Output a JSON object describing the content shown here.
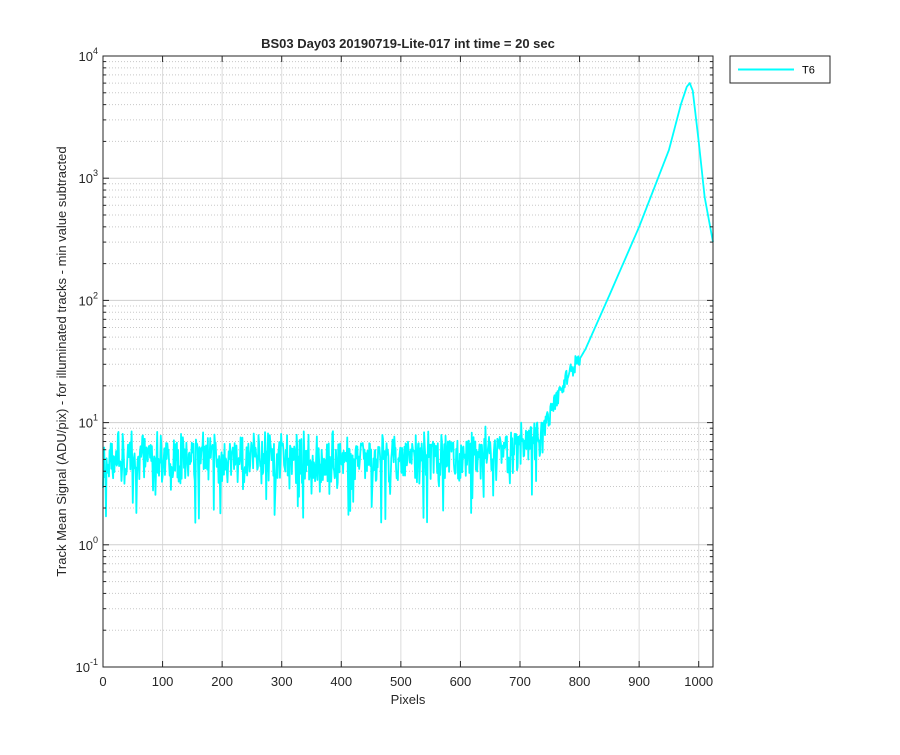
{
  "chart_data": {
    "type": "line",
    "title": "BS03 Day03 20190719-Lite-017 int time = 20 sec",
    "xlabel": "Pixels",
    "ylabel": "Track Mean Signal (ADU/pix) - for illuminated tracks - min value subtracted",
    "xlim": [
      0,
      1024
    ],
    "ylim": [
      0.1,
      10000
    ],
    "yscale": "log",
    "grid": "on (major and minor, log y)",
    "legend_position": "outside top-right",
    "x_ticks": [
      "0",
      "100",
      "200",
      "300",
      "400",
      "500",
      "600",
      "700",
      "800",
      "900",
      "1000"
    ],
    "y_ticks": [
      {
        "base": "10",
        "exp": "-1"
      },
      {
        "base": "10",
        "exp": "0"
      },
      {
        "base": "10",
        "exp": "1"
      },
      {
        "base": "10",
        "exp": "2"
      },
      {
        "base": "10",
        "exp": "3"
      },
      {
        "base": "10",
        "exp": "4"
      }
    ],
    "series": [
      {
        "name": "T6",
        "color": "#00FFFF",
        "noise_region": {
          "x_range": [
            0,
            740
          ],
          "typical_value": 5,
          "min_value": 0.85,
          "max_value": 10
        },
        "envelope": {
          "x": [
            0,
            100,
            200,
            300,
            400,
            500,
            600,
            680,
            720,
            740,
            760,
            780,
            800,
            810,
            850,
            900,
            950,
            970,
            980,
            985,
            990,
            1000,
            1010,
            1024
          ],
          "y": [
            5,
            5,
            5,
            5,
            5,
            5,
            5.2,
            5.8,
            7,
            9,
            15,
            25,
            33,
            40,
            110,
            400,
            1700,
            4000,
            5600,
            6000,
            5200,
            2000,
            700,
            300
          ]
        }
      }
    ]
  }
}
